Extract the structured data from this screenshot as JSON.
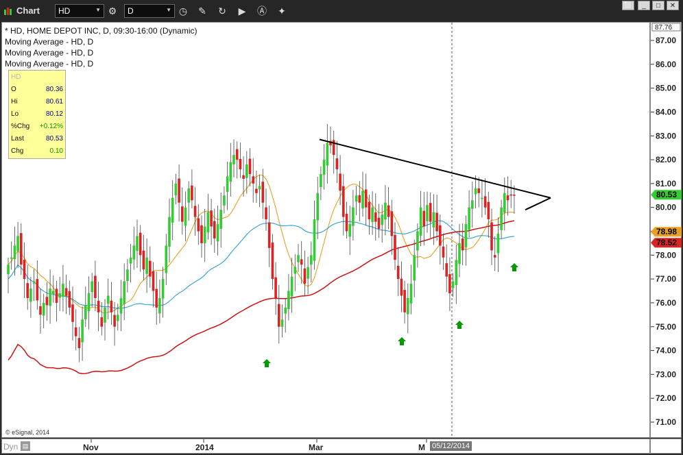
{
  "window": {
    "title": "Chart",
    "symbol_value": "HD",
    "interval_value": "D",
    "buttons": {
      "minimize": "_",
      "restore": "□",
      "close": "✕",
      "pin": "⬜"
    }
  },
  "legend": {
    "main": "* HD, HOME DEPOT INC, D, 09:30-16:00 (Dynamic)",
    "ma1": "Moving Average - HD, D",
    "ma2": "Moving Average - HD, D",
    "ma3": "Moving Average - HD, D"
  },
  "databox": {
    "title": "HD",
    "rows": [
      {
        "label": "O",
        "value": "80.36"
      },
      {
        "label": "Hi",
        "value": "80.61"
      },
      {
        "label": "Lo",
        "value": "80.12"
      },
      {
        "label": "%Chg",
        "value": "+0.12%"
      },
      {
        "label": "Last",
        "value": "80.53"
      },
      {
        "label": "Chg",
        "value": "0.10"
      }
    ]
  },
  "footer": {
    "copyright": "© eSignal, 2014",
    "dyn": "Dyn",
    "cursor_date": "05/12/2014"
  },
  "colors": {
    "up": "#33cc33",
    "down": "#dd2222",
    "ma_orange": "#e8a020",
    "ma_blue": "#2a9fd6",
    "ma_red": "#cc1111",
    "trendline": "#000000",
    "arrow": "#009900"
  },
  "icons": [
    "chart-icon",
    "settings-icon",
    "clock-icon",
    "pencil-icon",
    "refresh-icon",
    "play-icon",
    "alert-icon",
    "tools-icon"
  ],
  "chart_data": {
    "type": "candlestick",
    "title": "* HD, HOME DEPOT INC, D, 09:30-16:00 (Dynamic)",
    "ylim": [
      70.5,
      87.9
    ],
    "y_ticks": [
      "71.00",
      "72.00",
      "73.00",
      "74.00",
      "75.00",
      "76.00",
      "77.00",
      "78.00",
      "79.00",
      "80.00",
      "81.00",
      "82.00",
      "83.00",
      "84.00",
      "85.00",
      "86.00",
      "87.00"
    ],
    "y_top_label": "87.76",
    "x_tick_labels": [
      "Nov",
      "2014",
      "Mar",
      "M"
    ],
    "price_labels": [
      {
        "value": 80.53,
        "text": "80.53",
        "color": "#33cc33"
      },
      {
        "value": 78.98,
        "text": "78.98",
        "color": "#e8a020"
      },
      {
        "value": 78.52,
        "text": "78.52",
        "color": "#dd2222"
      }
    ],
    "series_closes": [
      77.6,
      77.9,
      78.4,
      78.8,
      77.6,
      77.0,
      76.2,
      76.6,
      76.9,
      76.1,
      75.5,
      76.0,
      75.9,
      76.6,
      76.5,
      76.0,
      76.4,
      76.8,
      76.3,
      75.8,
      75.2,
      74.6,
      74.1,
      75.3,
      75.9,
      76.4,
      76.9,
      76.2,
      75.6,
      75.0,
      75.8,
      76.3,
      75.6,
      75.0,
      75.5,
      76.2,
      76.9,
      77.4,
      77.9,
      78.4,
      78.8,
      78.0,
      77.4,
      77.9,
      77.1,
      76.5,
      75.8,
      76.2,
      77.0,
      78.4,
      79.6,
      80.4,
      81.0,
      80.2,
      79.4,
      80.0,
      80.8,
      80.3,
      79.6,
      79.0,
      78.5,
      79.2,
      79.8,
      79.2,
      78.7,
      79.3,
      79.9,
      80.5,
      81.3,
      81.9,
      82.2,
      82.0,
      81.6,
      81.2,
      81.8,
      81.4,
      81.0,
      80.6,
      80.9,
      80.2,
      79.5,
      78.3,
      77.0,
      76.2,
      75.0,
      75.3,
      75.8,
      76.5,
      77.1,
      77.5,
      78.0,
      77.6,
      76.8,
      77.5,
      78.0,
      79.5,
      80.6,
      81.4,
      82.0,
      82.7,
      82.6,
      82.2,
      81.6,
      80.7,
      79.6,
      79.0,
      79.3,
      80.0,
      80.5,
      80.2,
      80.7,
      80.0,
      79.5,
      80.0,
      79.4,
      79.1,
      79.7,
      80.2,
      79.6,
      78.8,
      77.8,
      77.0,
      76.3,
      75.6,
      76.2,
      76.8,
      78.0,
      79.0,
      80.0,
      79.2,
      80.1,
      79.4,
      79.8,
      79.0,
      78.4,
      77.9,
      77.1,
      76.4,
      76.9,
      77.8,
      78.5,
      78.2,
      79.3,
      80.0,
      80.3,
      80.8,
      80.6,
      80.4,
      80.0,
      79.5,
      78.2,
      77.9,
      78.9,
      80.0,
      80.6,
      80.3,
      80.5,
      80.53
    ],
    "moving_averages": [
      {
        "color": "#e8a020",
        "last": 78.98
      },
      {
        "color": "#2a9fd6",
        "last": 78.98
      },
      {
        "color": "#cc1111",
        "last": 78.52
      }
    ],
    "trendline": {
      "from": 82.85,
      "to": 80.4
    },
    "signal_arrows": 4
  }
}
